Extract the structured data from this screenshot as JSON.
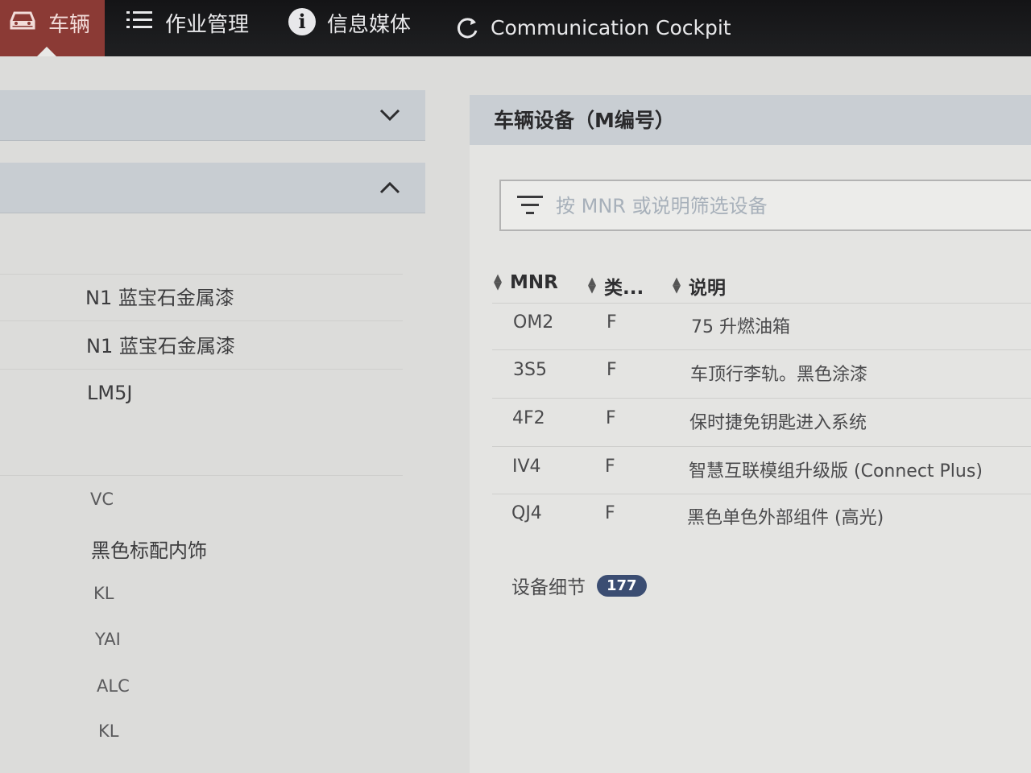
{
  "nav": {
    "tabs": [
      {
        "label": "车辆",
        "icon": "car-icon"
      },
      {
        "label": "作业管理",
        "icon": "list-icon"
      },
      {
        "label": "信息媒体",
        "icon": "info-icon"
      },
      {
        "label": "Communication Cockpit",
        "icon": "refresh-icon"
      }
    ]
  },
  "left": {
    "rows": [
      "N1 蓝宝石金属漆",
      "N1 蓝宝石金属漆",
      "LM5J",
      "VC",
      "黑色标配内饰",
      "KL",
      "YAI",
      "ALC",
      "KL"
    ]
  },
  "equipment": {
    "title": "车辆设备（M编号）",
    "filter_placeholder": "按 MNR 或说明筛选设备",
    "columns": [
      "MNR",
      "类...",
      "说明"
    ],
    "rows": [
      {
        "mnr": "OM2",
        "type": "F",
        "desc": "75 升燃油箱"
      },
      {
        "mnr": "3S5",
        "type": "F",
        "desc": "车顶行李轨。黑色涂漆"
      },
      {
        "mnr": "4F2",
        "type": "F",
        "desc": "保时捷免钥匙进入系统"
      },
      {
        "mnr": "IV4",
        "type": "F",
        "desc": "智慧互联模组升级版 (Connect Plus)"
      },
      {
        "mnr": "QJ4",
        "type": "F",
        "desc": "黑色单色外部组件 (高光)"
      }
    ],
    "details_label": "设备细节",
    "details_count": "177"
  },
  "colors": {
    "active_tab": "#8b3a35",
    "topbar": "#1a1a1c",
    "header_band": "#c9ced3",
    "badge": "#3b4d72"
  }
}
